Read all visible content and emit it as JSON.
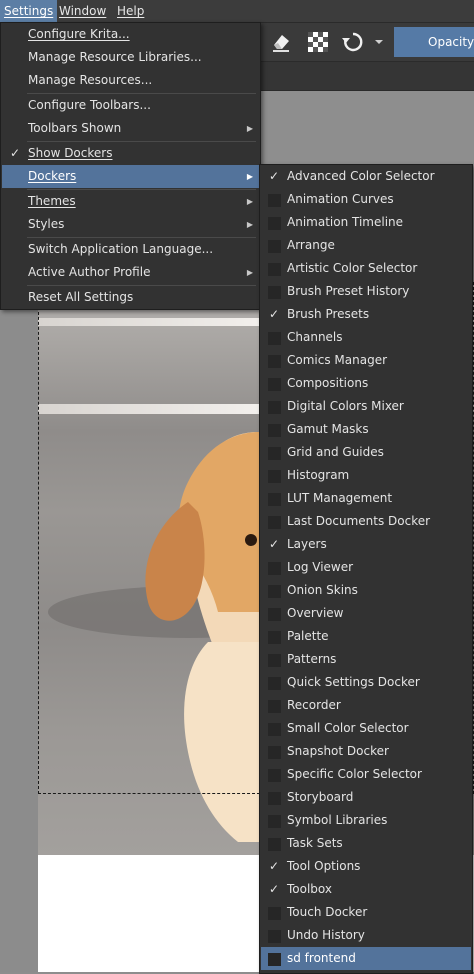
{
  "menubar": {
    "items": [
      "Settings",
      "Window",
      "Help"
    ]
  },
  "toolbar": {
    "opacity_label": "Opacity:",
    "icons": [
      "eraser-icon",
      "checkerboard-icon",
      "refresh-icon",
      "dropdown-arrow-icon"
    ]
  },
  "settings_menu": {
    "items": [
      {
        "label": "Configure Krita..."
      },
      {
        "label": "Manage Resource Libraries..."
      },
      {
        "label": "Manage Resources..."
      },
      {
        "label": "Configure Toolbars..."
      },
      {
        "label": "Toolbars Shown",
        "submenu": true
      },
      {
        "label": "Show Dockers",
        "checked": true
      },
      {
        "label": "Dockers",
        "submenu": true,
        "highlighted": true
      },
      {
        "label": "Themes",
        "submenu": true
      },
      {
        "label": "Styles",
        "submenu": true
      },
      {
        "label": "Switch Application Language..."
      },
      {
        "label": "Active Author Profile",
        "submenu": true
      },
      {
        "label": "Reset All Settings"
      }
    ]
  },
  "dockers_menu": {
    "items": [
      {
        "label": "Advanced Color Selector",
        "checked": true
      },
      {
        "label": "Animation Curves",
        "checked": false
      },
      {
        "label": "Animation Timeline",
        "checked": false
      },
      {
        "label": "Arrange",
        "checked": false
      },
      {
        "label": "Artistic Color Selector",
        "checked": false
      },
      {
        "label": "Brush Preset History",
        "checked": false
      },
      {
        "label": "Brush Presets",
        "checked": true
      },
      {
        "label": "Channels",
        "checked": false
      },
      {
        "label": "Comics Manager",
        "checked": false
      },
      {
        "label": "Compositions",
        "checked": false
      },
      {
        "label": "Digital Colors Mixer",
        "checked": false
      },
      {
        "label": "Gamut Masks",
        "checked": false
      },
      {
        "label": "Grid and Guides",
        "checked": false
      },
      {
        "label": "Histogram",
        "checked": false
      },
      {
        "label": "LUT Management",
        "checked": false
      },
      {
        "label": "Last Documents Docker",
        "checked": false
      },
      {
        "label": "Layers",
        "checked": true
      },
      {
        "label": "Log Viewer",
        "checked": false
      },
      {
        "label": "Onion Skins",
        "checked": false
      },
      {
        "label": "Overview",
        "checked": false
      },
      {
        "label": "Palette",
        "checked": false
      },
      {
        "label": "Patterns",
        "checked": false
      },
      {
        "label": "Quick Settings Docker",
        "checked": false
      },
      {
        "label": "Recorder",
        "checked": false
      },
      {
        "label": "Small Color Selector",
        "checked": false
      },
      {
        "label": "Snapshot Docker",
        "checked": false
      },
      {
        "label": "Specific Color Selector",
        "checked": false
      },
      {
        "label": "Storyboard",
        "checked": false
      },
      {
        "label": "Symbol Libraries",
        "checked": false
      },
      {
        "label": "Task Sets",
        "checked": false
      },
      {
        "label": "Tool Options",
        "checked": true
      },
      {
        "label": "Toolbox",
        "checked": true
      },
      {
        "label": "Touch Docker",
        "checked": false
      },
      {
        "label": "Undo History",
        "checked": false
      },
      {
        "label": "sd frontend",
        "checked": false,
        "highlighted": true
      }
    ]
  },
  "colors": {
    "highlight": "#53739b",
    "menu_bg": "#323232",
    "accent": "#557aa6"
  }
}
